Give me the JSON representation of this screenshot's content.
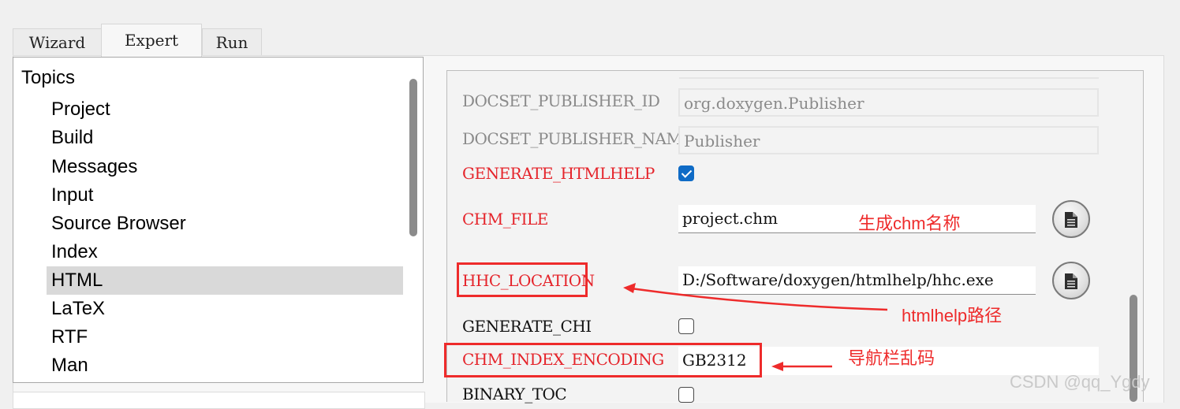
{
  "tabs": [
    {
      "label": "Wizard",
      "active": false
    },
    {
      "label": "Expert",
      "active": true
    },
    {
      "label": "Run",
      "active": false
    }
  ],
  "topics": {
    "title": "Topics",
    "items": [
      "Project",
      "Build",
      "Messages",
      "Input",
      "Source Browser",
      "Index",
      "HTML",
      "LaTeX",
      "RTF",
      "Man"
    ],
    "selected": "HTML"
  },
  "options": {
    "docset_publisher_id": {
      "label": "DOCSET_PUBLISHER_ID",
      "value": "org.doxygen.Publisher",
      "enabled": false
    },
    "docset_publisher_name": {
      "label": "DOCSET_PUBLISHER_NAME",
      "value": "Publisher",
      "enabled": false
    },
    "generate_htmlhelp": {
      "label": "GENERATE_HTMLHELP",
      "checked": true
    },
    "chm_file": {
      "label": "CHM_FILE",
      "value": "project.chm"
    },
    "hhc_location": {
      "label": "HHC_LOCATION",
      "value": "D:/Software/doxygen/htmlhelp/hhc.exe"
    },
    "generate_chi": {
      "label": "GENERATE_CHI",
      "checked": false
    },
    "chm_index_encoding": {
      "label": "CHM_INDEX_ENCODING",
      "value": "GB2312"
    },
    "binary_toc": {
      "label": "BINARY_TOC",
      "checked": false
    }
  },
  "annotations": {
    "chm_name": "生成chm名称",
    "htmlhelp_path": "htmlhelp路径",
    "nav_garbled": "导航栏乱码"
  },
  "watermark": "CSDN @qq_Ygdy",
  "colors": {
    "modified_option": "#e5242b",
    "disabled_option": "#8a8a8a",
    "annotation": "#ee2b2b",
    "checkbox_checked": "#0f6bc6",
    "selected_topic": "#d9d9d9"
  },
  "icons": {
    "browse_button": "document-icon",
    "checkmark": "check-icon"
  }
}
